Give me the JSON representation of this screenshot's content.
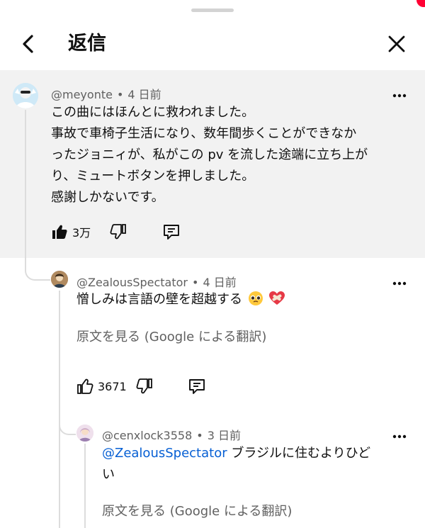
{
  "header": {
    "title": "返信"
  },
  "parent": {
    "author": "@meyonte",
    "time": "4 日前",
    "lines": [
      "この曲にはほんとに救われました。",
      "事故で車椅子生活になり、数年間歩くことができなか",
      "ったジョニィが、私がこの pv を流した途端に立ち上が",
      "り、ミュートボタンを押しました。",
      "感謝しかないです。"
    ],
    "likes": "3万"
  },
  "reply1": {
    "author": "@ZealousSpectator",
    "time": "4 日前",
    "text": "憎しみは言語の壁を超越する",
    "translate": "原文を見る (Google による翻訳)",
    "likes": "3671"
  },
  "reply2": {
    "author": "@cenxlock3558",
    "time": "3 日前",
    "mention": "@ZealousSpectator",
    "text_line1": " ブラジルに住むよりひど",
    "text_line2": "い",
    "translate": "原文を見る (Google による翻訳)"
  },
  "colors": {
    "link": "#065fd4",
    "parent_bg": "#f2f2f2",
    "notification": "#ff0033"
  }
}
